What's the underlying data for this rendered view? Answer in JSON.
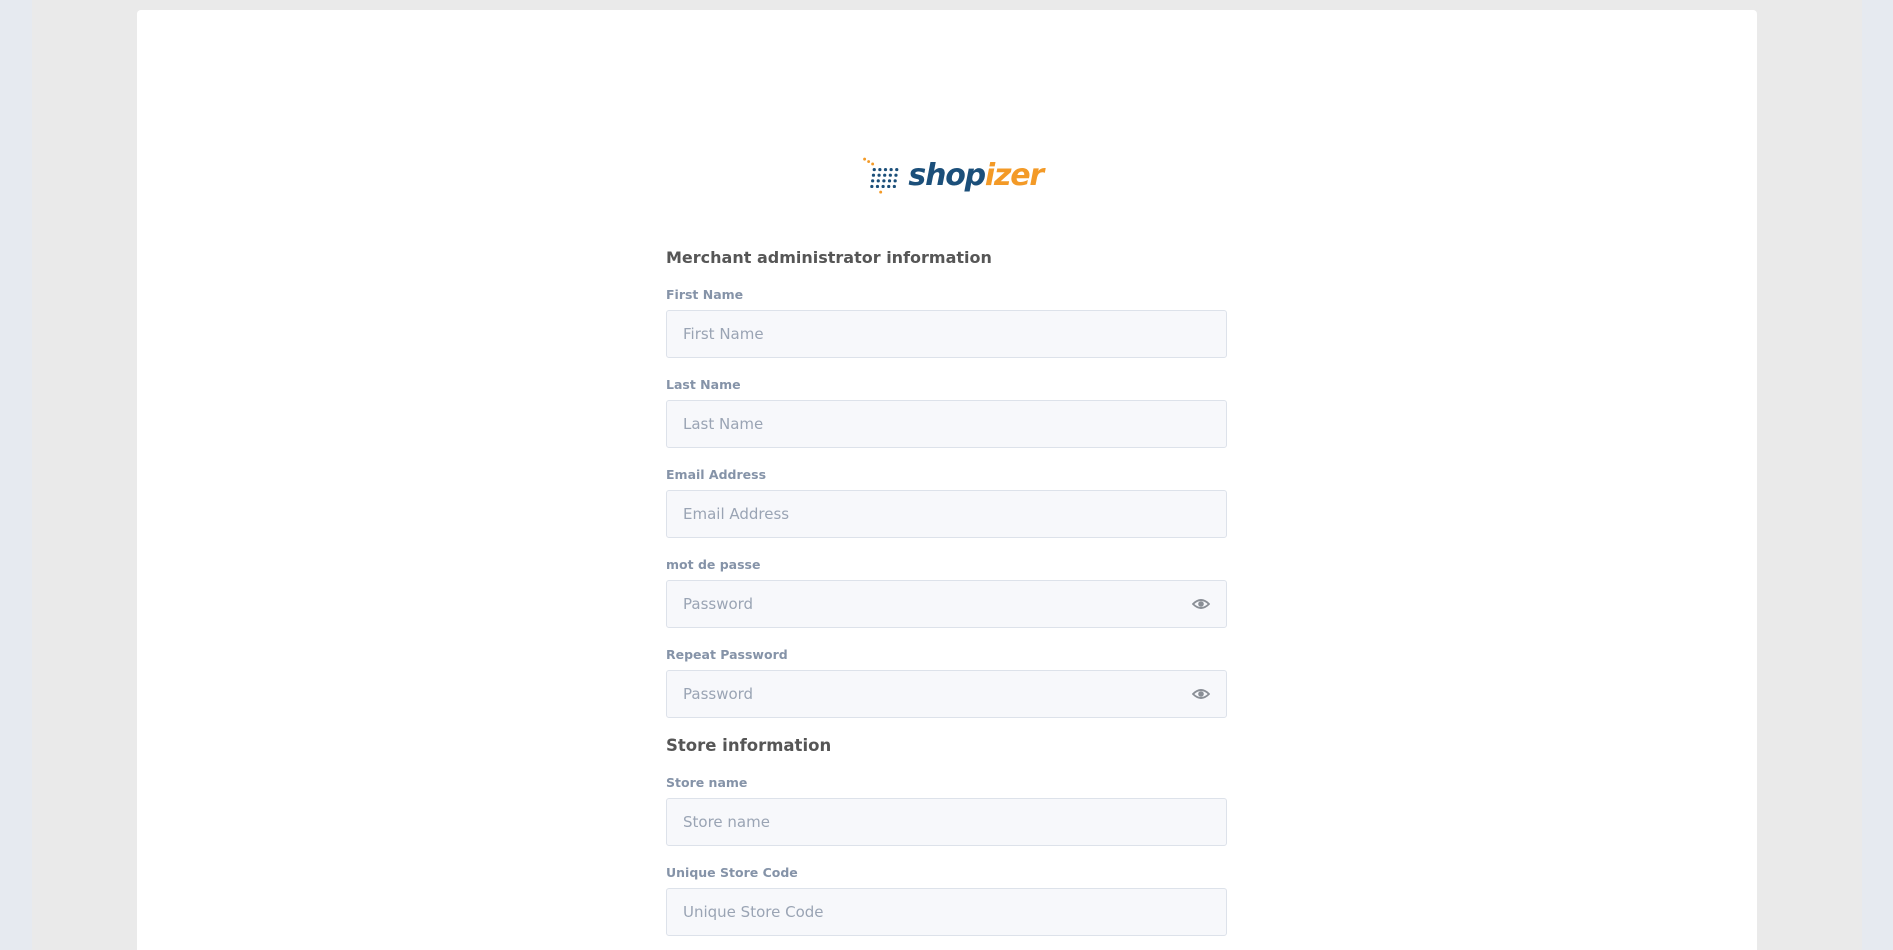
{
  "brand": {
    "logo_prefix": "shop",
    "logo_suffix": "izer",
    "colors": {
      "dark_blue": "#1b4f7a",
      "orange": "#f39a27"
    }
  },
  "admin_section": {
    "title": "Merchant administrator information",
    "fields": {
      "first_name": {
        "label": "First Name",
        "placeholder": "First Name",
        "value": ""
      },
      "last_name": {
        "label": "Last Name",
        "placeholder": "Last Name",
        "value": ""
      },
      "email": {
        "label": "Email Address",
        "placeholder": "Email Address",
        "value": ""
      },
      "password": {
        "label": "mot de passe",
        "placeholder": "Password",
        "value": ""
      },
      "repeat_password": {
        "label": "Repeat Password",
        "placeholder": "Password",
        "value": ""
      }
    }
  },
  "store_section": {
    "title": "Store information",
    "fields": {
      "store_name": {
        "label": "Store name",
        "placeholder": "Store name",
        "value": ""
      },
      "store_code": {
        "label": "Unique Store Code",
        "placeholder": "Unique Store Code",
        "value": ""
      }
    }
  },
  "icons": {
    "password_toggle": "eye-icon",
    "logo_mark": "dot-grid-logo-icon"
  }
}
